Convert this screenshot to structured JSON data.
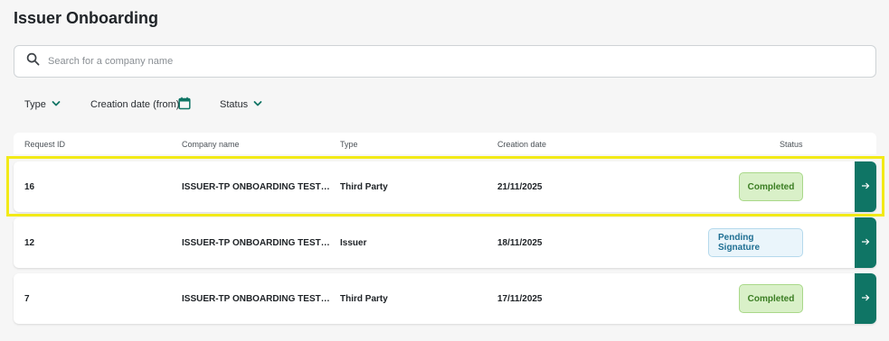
{
  "page": {
    "title": "Issuer Onboarding"
  },
  "search": {
    "placeholder": "Search for a company name",
    "value": ""
  },
  "filters": {
    "type_label": "Type",
    "creation_date_label": "Creation date (from)",
    "status_label": "Status"
  },
  "table": {
    "columns": {
      "request_id": "Request ID",
      "company_name": "Company name",
      "type": "Type",
      "creation_date": "Creation date",
      "status": "Status"
    },
    "rows": [
      {
        "id": "16",
        "company": "ISSUER-TP ONBOARDING TEST E...",
        "type": "Third Party",
        "date": "21/11/2025",
        "status": "Completed"
      },
      {
        "id": "12",
        "company": "ISSUER-TP ONBOARDING TEST E...",
        "type": "Issuer",
        "date": "18/11/2025",
        "status": "Pending Signature"
      },
      {
        "id": "7",
        "company": "ISSUER-TP ONBOARDING TEST E...",
        "type": "Third Party",
        "date": "17/11/2025",
        "status": "Completed"
      }
    ]
  },
  "icons": {
    "search": "search-icon",
    "dropdown": "chevron-down-icon",
    "calendar": "calendar-icon",
    "row_open": "arrow-right-icon"
  },
  "colors": {
    "accent": "#0f7565",
    "completed_bg": "#d9f0c8",
    "completed_text": "#3a7d22",
    "pending_bg": "#eaf5fb",
    "pending_text": "#1f6f93",
    "highlight": "#f2ea17"
  }
}
